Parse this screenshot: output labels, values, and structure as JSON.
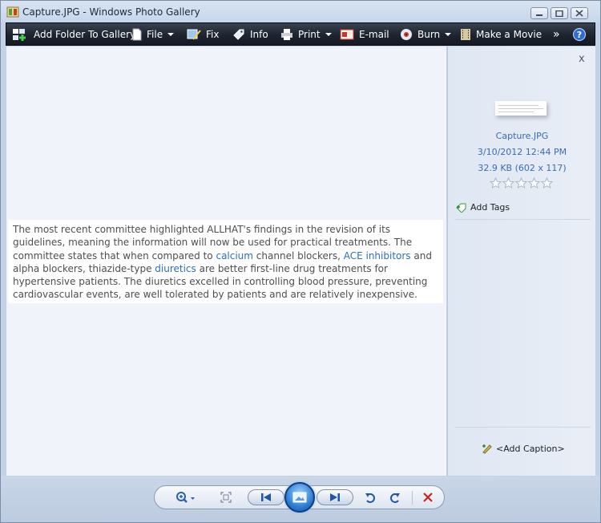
{
  "window": {
    "title": "Capture.JPG - Windows Photo Gallery"
  },
  "toolbar": {
    "add_folder": "Add Folder To Gallery",
    "file": "File",
    "fix": "Fix",
    "info": "Info",
    "print": "Print",
    "email": "E-mail",
    "burn": "Burn",
    "make_movie": "Make a Movie",
    "overflow": "»"
  },
  "photo": {
    "line1": "The most recent committee highlighted ALLHAT's findings in the revision of its",
    "line2": "guidelines, meaning the information will now be used for practical treatments. The",
    "line3a": "committee states that when compared to ",
    "line3_link1": "calcium",
    "line3b": " channel blockers, ",
    "line3_link2": "ACE inhibitors",
    "line3c": " and",
    "line4a": "alpha blockers, thiazide-type ",
    "line4_link": "diuretics",
    "line4b": " are better first-line drug treatments for",
    "line5": "hypertensive patients. The diuretics excelled in controlling blood pressure, preventing",
    "line6": "cardiovascular events, are well tolerated by patients and are relatively inexpensive."
  },
  "info_pane": {
    "close": "x",
    "filename": "Capture.JPG",
    "datetime": "3/10/2012   12:44 PM",
    "filesize": "32.9 KB (602 x 117)",
    "rating": 0,
    "add_tags": "Add Tags",
    "add_caption": "<Add Caption>"
  },
  "colors": {
    "link": "#2e6ec0",
    "toolbar_bg": "#1e2430",
    "delete_red": "#d02020"
  }
}
